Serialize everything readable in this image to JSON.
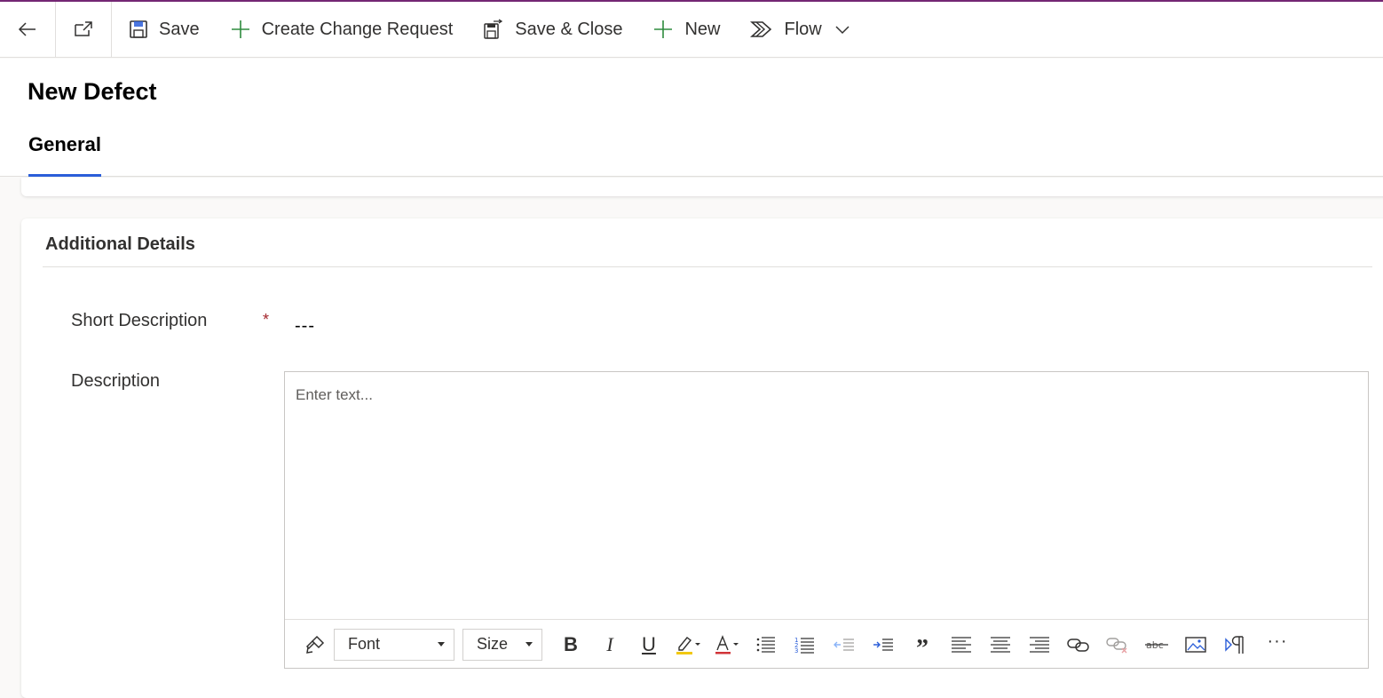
{
  "commandbar": {
    "save_label": "Save",
    "create_change_request_label": "Create Change Request",
    "save_close_label": "Save & Close",
    "new_label": "New",
    "flow_label": "Flow"
  },
  "form": {
    "title": "New Defect",
    "tabs": [
      {
        "label": "General",
        "selected": true
      }
    ]
  },
  "section": {
    "title": "Additional Details",
    "fields": {
      "short_description": {
        "label": "Short Description",
        "required_marker": "*",
        "value": "---"
      },
      "description": {
        "label": "Description",
        "placeholder": "Enter text..."
      }
    }
  },
  "rte_toolbar": {
    "font_label": "Font",
    "size_label": "Size",
    "bold_label": "B",
    "italic_label": "I",
    "underline_label": "U",
    "quote_label": "”",
    "more_label": "···"
  },
  "colors": {
    "accent_top": "#742774",
    "tab_underline": "#2b5ed9",
    "add_green": "#2e8b3e",
    "required_red": "#a4262c"
  }
}
